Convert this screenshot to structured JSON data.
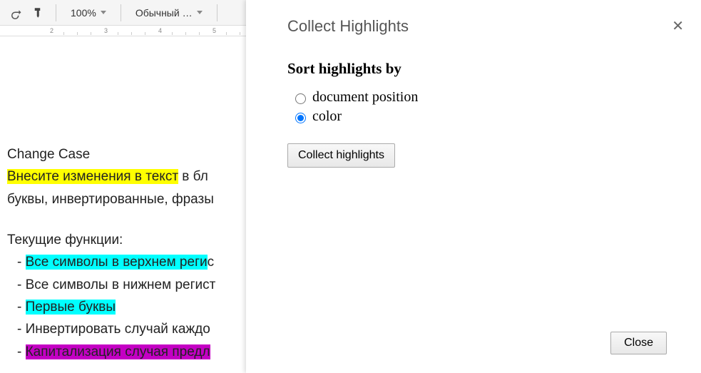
{
  "toolbar": {
    "zoom": "100%",
    "style": "Обычный …"
  },
  "ruler": {
    "ticks": [
      "2",
      "3",
      "4",
      "5"
    ]
  },
  "document": {
    "title_line": "Change Case",
    "line2_hl": "Внесите изменения в текст",
    "line2_rest": " в бл",
    "line3": "буквы, инвертированные, фразы",
    "functions_label": "Текущие функции:",
    "items": [
      {
        "prefix": "  - ",
        "hl": "Все символы в верхнем реги",
        "rest": "с",
        "cls": "hl-cyan"
      },
      {
        "prefix": "  - ",
        "hl": "",
        "rest": "Все символы в нижнем регист",
        "cls": ""
      },
      {
        "prefix": "  - ",
        "hl": "Первые буквы",
        "rest": "",
        "cls": "hl-cyan"
      },
      {
        "prefix": "  - ",
        "hl": "",
        "rest": "Инвертировать случай каждо",
        "cls": ""
      },
      {
        "prefix": "  - ",
        "hl": "Капитализация случая предл",
        "rest": "",
        "cls": "hl-magenta"
      }
    ],
    "highlight_colors": {
      "yellow": "#ffff00",
      "cyan": "#00ffff",
      "magenta": "#c400c4"
    }
  },
  "panel": {
    "title": "Collect Highlights",
    "sort_heading": "Sort highlights by",
    "radio_doc_position": "document position",
    "radio_color": "color",
    "selected": "color",
    "collect_button": "Collect highlights",
    "close_button": "Close"
  }
}
